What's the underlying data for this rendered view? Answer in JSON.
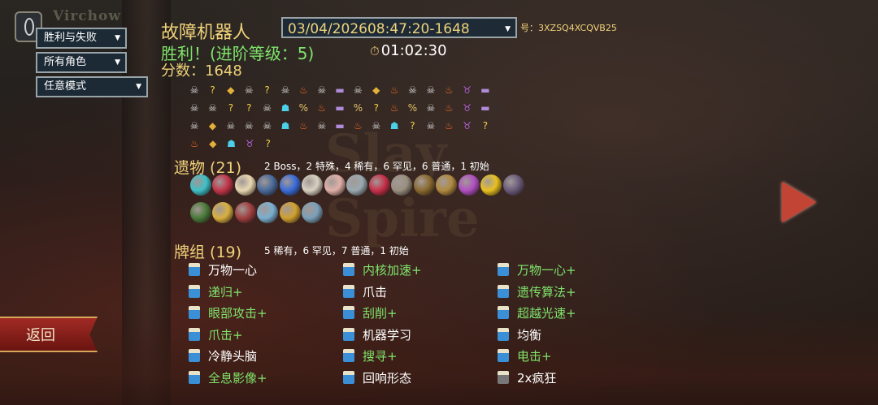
{
  "player_name": "Virchow",
  "filters": [
    "胜利与失败",
    "所有角色",
    "任意模式"
  ],
  "run": {
    "character": "故障机器人",
    "result": "胜利！(进阶等级：5)",
    "score": "分数：1648",
    "seed_dropdown": "03/04/202608:47:20-1648",
    "seed_label": "号：3XZSQ4XCQVB25",
    "time": "01:02:30"
  },
  "path": {
    "rows": [
      [
        "monster-icon",
        "unknown-icon",
        "treasure-icon",
        "monster-icon",
        "unknown-icon",
        "monster-icon",
        "campfire-icon",
        "monster-icon",
        "chest-icon",
        "monster-icon",
        "treasure-icon",
        "campfire-icon",
        "monster-icon",
        "monster-icon",
        "campfire-icon",
        "boss-icon",
        "chest-icon"
      ],
      [
        "monster-icon",
        "monster-icon",
        "unknown-icon",
        "unknown-icon",
        "monster-icon",
        "elite-icon",
        "event-icon",
        "campfire-icon",
        "chest-icon",
        "event-icon",
        "unknown-icon",
        "campfire-icon",
        "event-icon",
        "monster-icon",
        "campfire-icon",
        "boss-icon",
        "chest-icon"
      ],
      [
        "monster-icon",
        "treasure-icon",
        "monster-icon",
        "monster-icon",
        "monster-icon",
        "elite-icon",
        "campfire-icon",
        "monster-icon",
        "chest-icon",
        "campfire-icon",
        "monster-icon",
        "elite-icon",
        "unknown-icon",
        "monster-icon",
        "campfire-icon",
        "boss-icon",
        "unknown-icon"
      ],
      [
        "campfire-icon",
        "treasure-icon",
        "elite-icon",
        "boss-icon",
        "unknown-icon"
      ]
    ],
    "legend": {
      "monster-icon": "☠",
      "unknown-icon": "?",
      "treasure-icon": "◆",
      "elite-icon": "☗",
      "campfire-icon": "♨",
      "chest-icon": "▬",
      "event-icon": "%",
      "boss-icon": "♉"
    },
    "colors": {
      "monster-icon": "#d9d9d9",
      "unknown-icon": "#f0d245",
      "treasure-icon": "#e3b13a",
      "elite-icon": "#4cd0e8",
      "campfire-icon": "#f06a28",
      "chest-icon": "#b08cd8",
      "event-icon": "#e3c06a",
      "boss-icon": "#b060d8"
    }
  },
  "relics_section": {
    "title": "遗物 (21)",
    "summary": "2  Boss，2  特殊，4  稀有，6  罕见，6  普通，1  初始",
    "colors": [
      "#3fc0c8",
      "#c2364a",
      "#e8d8b0",
      "#4a6b9a",
      "#3a6cd8",
      "#d8d0c0",
      "#e0b0a8",
      "#9aa8b0",
      "#c8304a",
      "#9a9080",
      "#8a6a30",
      "#b08a40",
      "#b050c0",
      "#e8c020",
      "#6a5a7a",
      "#4a7a3a",
      "#d8b040",
      "#a04040",
      "#7ab0d0",
      "#d0a030",
      "#7aa0b8"
    ],
    "names": [
      "ice-cream-icon",
      "burning-blood-icon",
      "candle-icon",
      "whip-icon",
      "throne-icon",
      "feather-icon",
      "tea-set-icon",
      "orb-icon",
      "shrimp-icon",
      "wing-icon",
      "scroll-icon",
      "bag-icon",
      "fan-icon",
      "banana-icon",
      "star-icon",
      "dice-icon",
      "leaf-icon",
      "book-icon",
      "ring-icon",
      "flower-icon",
      "pillar-icon"
    ]
  },
  "deck_section": {
    "title": "牌组 (19)",
    "summary": "5  稀有，6  罕见，7  普通，1  初始",
    "cards": [
      {
        "label": "万物一心",
        "up": false,
        "col": 0,
        "row": 0
      },
      {
        "label": "内核加速+",
        "up": true,
        "col": 1,
        "row": 0
      },
      {
        "label": "万物一心+",
        "up": true,
        "col": 2,
        "row": 0
      },
      {
        "label": "递归+",
        "up": true,
        "col": 0,
        "row": 1
      },
      {
        "label": "爪击",
        "up": false,
        "col": 1,
        "row": 1
      },
      {
        "label": "遗传算法+",
        "up": true,
        "col": 2,
        "row": 1
      },
      {
        "label": "眼部攻击+",
        "up": true,
        "col": 0,
        "row": 2
      },
      {
        "label": "刮削+",
        "up": true,
        "col": 1,
        "row": 2
      },
      {
        "label": "超越光速+",
        "up": true,
        "col": 2,
        "row": 2
      },
      {
        "label": "爪击+",
        "up": true,
        "col": 0,
        "row": 3
      },
      {
        "label": "机器学习",
        "up": false,
        "col": 1,
        "row": 3
      },
      {
        "label": "均衡",
        "up": false,
        "col": 2,
        "row": 3
      },
      {
        "label": "冷静头脑",
        "up": false,
        "col": 0,
        "row": 4
      },
      {
        "label": "搜寻+",
        "up": true,
        "col": 1,
        "row": 4
      },
      {
        "label": "电击+",
        "up": true,
        "col": 2,
        "row": 4
      },
      {
        "label": "全息影像+",
        "up": true,
        "col": 0,
        "row": 5
      },
      {
        "label": "回响形态",
        "up": false,
        "col": 1,
        "row": 5
      },
      {
        "label": "2x疯狂",
        "up": false,
        "col": 2,
        "row": 5,
        "gray": true
      }
    ]
  },
  "back_button": "返回",
  "watermark": [
    "Slay",
    "Spire"
  ]
}
